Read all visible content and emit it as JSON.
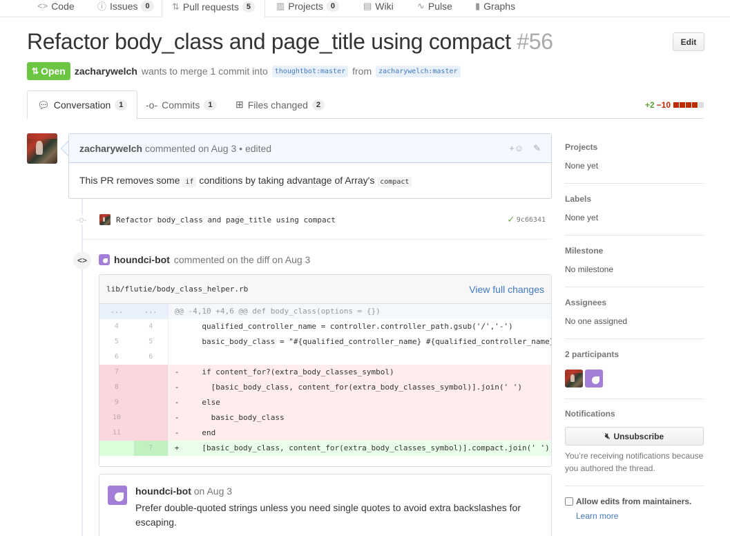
{
  "reponav": {
    "tabs": [
      {
        "label": "Code",
        "icon": "code-icon",
        "counter": ""
      },
      {
        "label": "Issues",
        "icon": "issue-icon",
        "counter": "0"
      },
      {
        "label": "Pull requests",
        "icon": "pull-request-icon",
        "counter": "5"
      },
      {
        "label": "Projects",
        "icon": "project-icon",
        "counter": "0"
      },
      {
        "label": "Wiki",
        "icon": "book-icon",
        "counter": ""
      },
      {
        "label": "Pulse",
        "icon": "pulse-icon",
        "counter": ""
      },
      {
        "label": "Graphs",
        "icon": "graph-icon",
        "counter": ""
      }
    ]
  },
  "pr": {
    "title": "Refactor body_class and page_title using compact",
    "number": "#56",
    "edit_label": "Edit",
    "state": "Open",
    "author": "zacharywelch",
    "merge_text_1": "wants to merge 1 commit into",
    "base_branch": "thoughtbot:master",
    "from_text": "from",
    "head_branch": "zacharywelch:master"
  },
  "tabnav": {
    "tabs": [
      {
        "label": "Conversation",
        "counter": "1"
      },
      {
        "label": "Commits",
        "counter": "1"
      },
      {
        "label": "Files changed",
        "counter": "2"
      }
    ],
    "additions": "+2",
    "deletions": "−10"
  },
  "comment": {
    "author": "zacharywelch",
    "meta": "commented on Aug 3",
    "edited": "• edited",
    "body_1": "This PR removes some",
    "code_1": "if",
    "body_2": "conditions by taking advantage of Array's",
    "code_2": "compact"
  },
  "commit": {
    "message": "Refactor body_class and page_title using compact",
    "sha": "9c66341"
  },
  "review": {
    "author": "houndci-bot",
    "meta": "commented on the diff on Aug 3",
    "file": "lib/flutie/body_class_helper.rb",
    "view_full": "View full changes",
    "lines": [
      {
        "type": "hunk",
        "old": "...",
        "new": "...",
        "code": "@@ -4,10 +4,6 @@ def body_class(options = {})"
      },
      {
        "type": "ctx",
        "old": "4",
        "new": "4",
        "code": "      qualified_controller_name = controller.controller_path.gsub('/','-')"
      },
      {
        "type": "ctx",
        "old": "5",
        "new": "5",
        "code": "      basic_body_class = \"#{qualified_controller_name} #{qualified_controller_name}-#{controller.action_name}\""
      },
      {
        "type": "ctx",
        "old": "6",
        "new": "6",
        "code": ""
      },
      {
        "type": "del",
        "old": "7",
        "new": "",
        "code": "-     if content_for?(extra_body_classes_symbol)"
      },
      {
        "type": "del",
        "old": "8",
        "new": "",
        "code": "-       [basic_body_class, content_for(extra_body_classes_symbol)].join(' ')"
      },
      {
        "type": "del",
        "old": "9",
        "new": "",
        "code": "-     else"
      },
      {
        "type": "del",
        "old": "10",
        "new": "",
        "code": "-       basic_body_class"
      },
      {
        "type": "del",
        "old": "11",
        "new": "",
        "code": "-     end"
      },
      {
        "type": "add",
        "old": "",
        "new": "7",
        "code": "+     [basic_body_class, content_for(extra_body_classes_symbol)].compact.join(' ')"
      }
    ]
  },
  "inline_comment": {
    "author": "houndci-bot",
    "meta": "on Aug 3",
    "body": "Prefer double-quoted strings unless you need single quotes to avoid extra backslashes for escaping."
  },
  "sidebar": {
    "projects_title": "Projects",
    "projects_value": "None yet",
    "labels_title": "Labels",
    "labels_value": "None yet",
    "milestone_title": "Milestone",
    "milestone_value": "No milestone",
    "assignees_title": "Assignees",
    "assignees_value": "No one assigned",
    "participants_title": "2 participants",
    "notifications_title": "Notifications",
    "unsubscribe_label": "Unsubscribe",
    "reason": "You’re receiving notifications because you authored the thread.",
    "allow_edits": "Allow edits from maintainers.",
    "learn_more": "Learn more"
  },
  "colors": {
    "open_state": "#6cc644",
    "addition": "#55a532",
    "deletion": "#bd2c00",
    "link": "#4078c0",
    "tab_accent": "#e36209"
  }
}
